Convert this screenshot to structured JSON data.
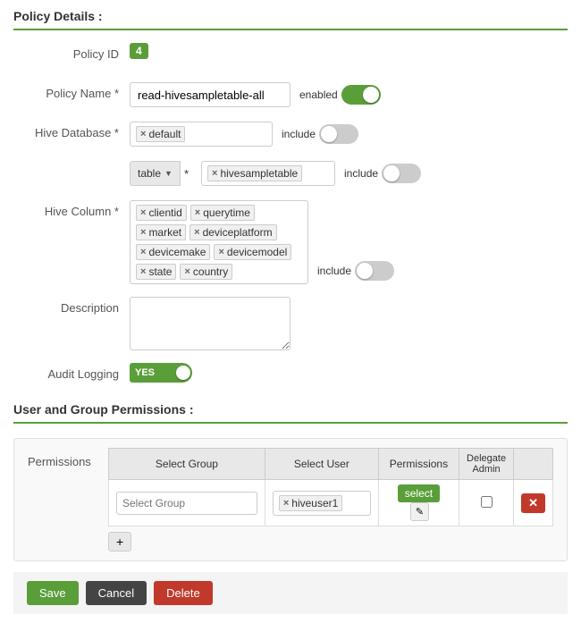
{
  "page": {
    "policy_section_title": "Policy Details :",
    "permissions_section_title": "User and Group Permissions :"
  },
  "policy": {
    "id_label": "Policy ID",
    "id_value": "4",
    "name_label": "Policy Name *",
    "name_value": "read-hivesampletable-all",
    "enabled_label": "enabled",
    "hive_db_label": "Hive Database *",
    "hive_db_tag": "default",
    "hive_db_include": "include",
    "table_dropdown_label": "table",
    "table_label": "*",
    "hive_table_tag": "hivesampletable",
    "hive_table_include": "include",
    "hive_column_label": "Hive Column *",
    "hive_column_tags": [
      "clientid",
      "querytime",
      "market",
      "deviceplatform",
      "devicemake",
      "devicemodel",
      "state",
      "country"
    ],
    "hive_column_include": "include",
    "description_label": "Description",
    "description_value": "",
    "audit_logging_label": "Audit Logging",
    "audit_logging_yes": "YES"
  },
  "permissions": {
    "label": "Permissions",
    "columns": {
      "select_group": "Select Group",
      "select_user": "Select User",
      "permissions": "Permissions",
      "delegate_admin": "Delegate Admin"
    },
    "row": {
      "select_group_placeholder": "Select Group",
      "select_user_tag": "hiveuser1",
      "select_btn_label": "select",
      "add_row_symbol": "+"
    }
  },
  "buttons": {
    "save": "Save",
    "cancel": "Cancel",
    "delete": "Delete"
  }
}
